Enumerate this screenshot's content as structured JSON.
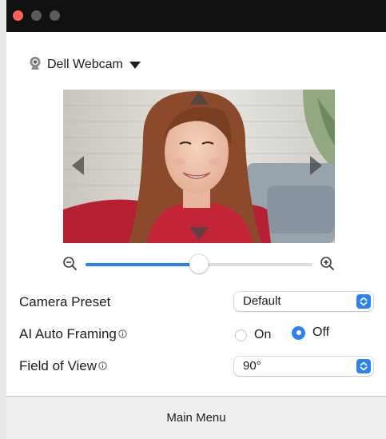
{
  "device": {
    "name": "Dell Webcam",
    "icon": "webcam-icon"
  },
  "preview": {
    "pan_controls": [
      "pan-up-arrow",
      "pan-down-arrow",
      "pan-left-arrow",
      "pan-right-arrow"
    ]
  },
  "zoom": {
    "level_fraction": 0.5,
    "out_icon": "zoom-out-icon",
    "in_icon": "zoom-in-icon"
  },
  "settings": {
    "camera_preset": {
      "label": "Camera Preset",
      "value": "Default"
    },
    "ai_auto_framing": {
      "label": "AI Auto Framing",
      "on_label": "On",
      "off_label": "Off",
      "selected": "Off"
    },
    "field_of_view": {
      "label": "Field of View",
      "value": "90°"
    }
  },
  "footer": {
    "main_menu_label": "Main Menu"
  },
  "colors": {
    "accent": "#2d82f0",
    "close": "#ff5f57",
    "titlebar": "#111111"
  }
}
